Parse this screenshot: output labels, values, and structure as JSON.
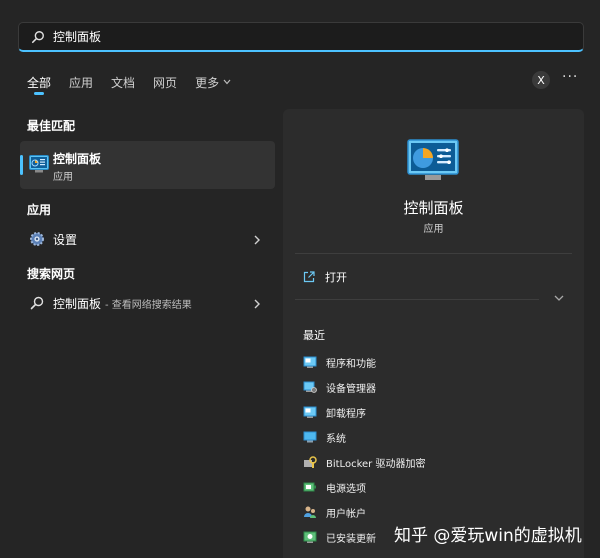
{
  "search": {
    "value": "控制面板"
  },
  "tabs": [
    {
      "label": "全部",
      "active": true
    },
    {
      "label": "应用"
    },
    {
      "label": "文档"
    },
    {
      "label": "网页"
    },
    {
      "label": "更多"
    }
  ],
  "header": {
    "avatar_letter": "X",
    "more_label": "···"
  },
  "left": {
    "best_match_title": "最佳匹配",
    "best_match": {
      "name": "控制面板",
      "sub": "应用",
      "icon": "control-panel-icon"
    },
    "apps_title": "应用",
    "apps": [
      {
        "label": "设置",
        "icon": "settings-gear-icon"
      }
    ],
    "web_title": "搜索网页",
    "web": [
      {
        "label": "控制面板",
        "hint": "- 查看网络搜索结果",
        "icon": "search-icon"
      }
    ]
  },
  "detail": {
    "title": "控制面板",
    "subtitle": "应用",
    "open_label": "打开",
    "recent_title": "最近",
    "recent": [
      {
        "label": "程序和功能",
        "icon": "programs-icon"
      },
      {
        "label": "设备管理器",
        "icon": "device-manager-icon"
      },
      {
        "label": "卸载程序",
        "icon": "uninstall-icon"
      },
      {
        "label": "系统",
        "icon": "system-icon"
      },
      {
        "label": "BitLocker 驱动器加密",
        "icon": "bitlocker-icon"
      },
      {
        "label": "电源选项",
        "icon": "power-options-icon"
      },
      {
        "label": "用户帐户",
        "icon": "user-accounts-icon"
      },
      {
        "label": "已安装更新",
        "icon": "installed-updates-icon"
      }
    ]
  },
  "watermark": "知乎 @爱玩win的虚拟机",
  "colors": {
    "accent": "#4cc2ff",
    "background": "#202020",
    "detail_bg": "#2c2c2c",
    "selected_bg": "#333333"
  }
}
